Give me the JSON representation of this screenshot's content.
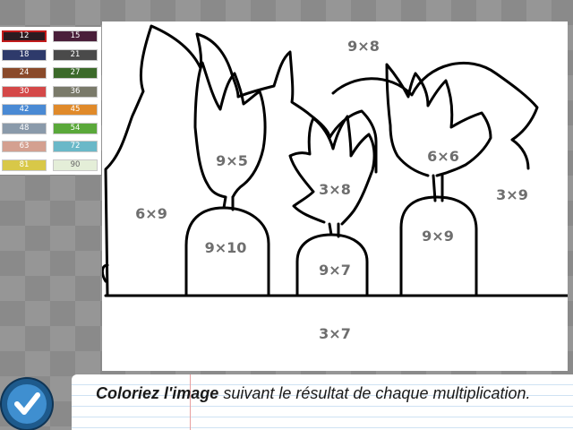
{
  "palette": [
    {
      "label": "12",
      "color": "#2b1b20",
      "selected": true
    },
    {
      "label": "15",
      "color": "#4a1f3a"
    },
    {
      "label": "18",
      "color": "#2e3a6b"
    },
    {
      "label": "21",
      "color": "#4a4a4a"
    },
    {
      "label": "24",
      "color": "#8a4a2a"
    },
    {
      "label": "27",
      "color": "#3c6a2a"
    },
    {
      "label": "30",
      "color": "#d44848"
    },
    {
      "label": "36",
      "color": "#7a7a6a"
    },
    {
      "label": "42",
      "color": "#4a8ad4"
    },
    {
      "label": "45",
      "color": "#e08a2a"
    },
    {
      "label": "48",
      "color": "#8a9aaa"
    },
    {
      "label": "54",
      "color": "#5aa83a"
    },
    {
      "label": "63",
      "color": "#d4a090"
    },
    {
      "label": "72",
      "color": "#6ab8c8"
    },
    {
      "label": "81",
      "color": "#d8c848"
    },
    {
      "label": "90",
      "color": "#e4eed8",
      "light": true
    }
  ],
  "zones": {
    "sky_top": "9×8",
    "leaves_1": "9×5",
    "leaves_2": "3×8",
    "leaves_3": "6×6",
    "bush_left": "6×9",
    "bush_right": "3×9",
    "carrot_1": "9×10",
    "carrot_2": "9×7",
    "carrot_3": "9×9",
    "ground": "3×7"
  },
  "instruction": {
    "bold": "Coloriez l'image",
    "rest": " suivant le résultat de chaque multiplication."
  },
  "colors": {
    "selected_border": "#c21a1a",
    "validate_button": "#3f8fd0"
  },
  "icons": {
    "validate": "checkmark-icon"
  }
}
